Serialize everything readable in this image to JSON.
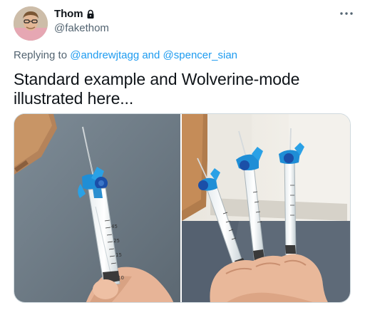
{
  "tweet": {
    "display_name": "Thom",
    "handle": "@fakethom",
    "replying_prefix": "Replying to",
    "reply_to_1": "@andrewjtagg",
    "reply_conjunction": "and",
    "reply_to_2": "@spencer_sian",
    "text": "Standard example and Wolverine-mode illustrated here...",
    "icons": {
      "lock": "lock-icon",
      "more": "more-icon"
    },
    "media": [
      {
        "name": "photo-standard-example",
        "syringe_markings": [
          "45",
          "25",
          "15",
          "10"
        ]
      },
      {
        "name": "photo-wolverine-mode"
      }
    ],
    "colors": {
      "link": "#1d9bf0",
      "text": "#0f1419",
      "secondary": "#536471",
      "cannula_blue": "#1f8ed6"
    }
  }
}
